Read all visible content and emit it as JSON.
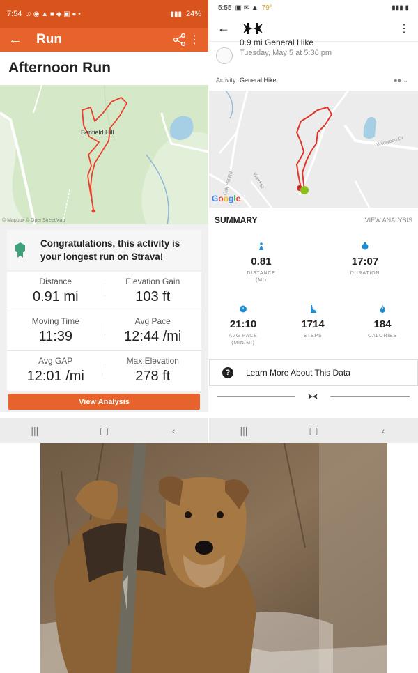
{
  "left": {
    "status": {
      "time": "7:54",
      "battery": "24%"
    },
    "appbar": {
      "title": "Run"
    },
    "heading": "Afternoon Run",
    "map": {
      "place_label": "Benfield Hill",
      "credit": "© Mapbox © OpenStreetMap"
    },
    "banner": {
      "message": "Congratulations, this activity is your longest run on Strava!"
    },
    "stats": [
      {
        "label": "Distance",
        "value": "0.91 mi"
      },
      {
        "label": "Elevation Gain",
        "value": "103 ft"
      },
      {
        "label": "Moving Time",
        "value": "11:39"
      },
      {
        "label": "Avg Pace",
        "value": "12:44 /mi"
      },
      {
        "label": "Avg GAP",
        "value": "12:01 /mi"
      },
      {
        "label": "Max Elevation",
        "value": "278 ft"
      }
    ],
    "button": "View Analysis",
    "colors": {
      "accent": "#e8632b",
      "route": "#e8412b"
    }
  },
  "right": {
    "status": {
      "time": "5:55",
      "temp": "79°"
    },
    "subhead": {
      "title": "0.9 mi General Hike",
      "date": "Tuesday, May 5 at 5:36 pm"
    },
    "activity": {
      "label": "Activity:",
      "value": "General Hike"
    },
    "map": {
      "google": "Google",
      "roads": [
        "Wildwood Dr",
        "Oak Hill Rd",
        "Ward St"
      ]
    },
    "summary": {
      "label": "SUMMARY",
      "view": "VIEW ANALYSIS"
    },
    "metrics": [
      {
        "value": "0.81",
        "label": "DISTANCE",
        "unit": "(MI)",
        "icon": "hiker-icon"
      },
      {
        "value": "17:07",
        "label": "DURATION",
        "unit": "",
        "icon": "stopwatch-icon"
      },
      {
        "value": "21:10",
        "label": "AVG PACE",
        "unit": "(MIN/MI)",
        "icon": "pace-icon"
      },
      {
        "value": "1714",
        "label": "STEPS",
        "unit": "",
        "icon": "shoe-icon"
      },
      {
        "value": "184",
        "label": "CALORIES",
        "unit": "",
        "icon": "flame-icon"
      }
    ],
    "learn": "Learn More About This Data",
    "colors": {
      "accent": "#1e8fd6",
      "route": "#e0362a"
    }
  }
}
